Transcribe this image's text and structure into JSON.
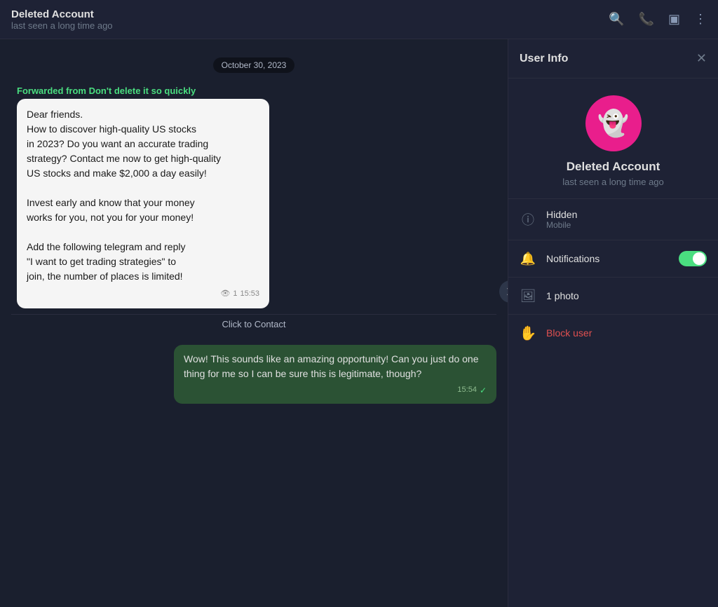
{
  "header": {
    "name": "Deleted Account",
    "status": "last seen a long time ago",
    "icons": [
      "search",
      "phone",
      "layout",
      "more"
    ]
  },
  "chat": {
    "date_divider": "October 30, 2023",
    "forwarded_label": "Forwarded from Don't delete it so quickly",
    "forwarded_message": "Dear friends.\nHow to discover high-quality US stocks\nin 2023? Do you want an accurate trading\nstrategy? Contact me now to get high-quality\nUS stocks and make $2,000 a day easily!\n\nInvest early and know that your money\nworks for you, not you for your money!\n\nAdd the following telegram and reply\n\"I want to get trading strategies\" to\njoin, the number of places is limited!",
    "forwarded_views": "1",
    "forwarded_time": "15:53",
    "click_to_contact": "Click to Contact",
    "outgoing_message": "Wow! This sounds like an amazing opportunity! Can you just do one thing for me so I can be sure this is legitimate, though?",
    "outgoing_time": "15:54"
  },
  "user_info": {
    "panel_title": "User Info",
    "name": "Deleted Account",
    "status": "last seen a long time ago",
    "hidden_label": "Hidden",
    "hidden_sublabel": "Mobile",
    "notifications_label": "Notifications",
    "photos_label": "1 photo",
    "block_label": "Block user"
  }
}
